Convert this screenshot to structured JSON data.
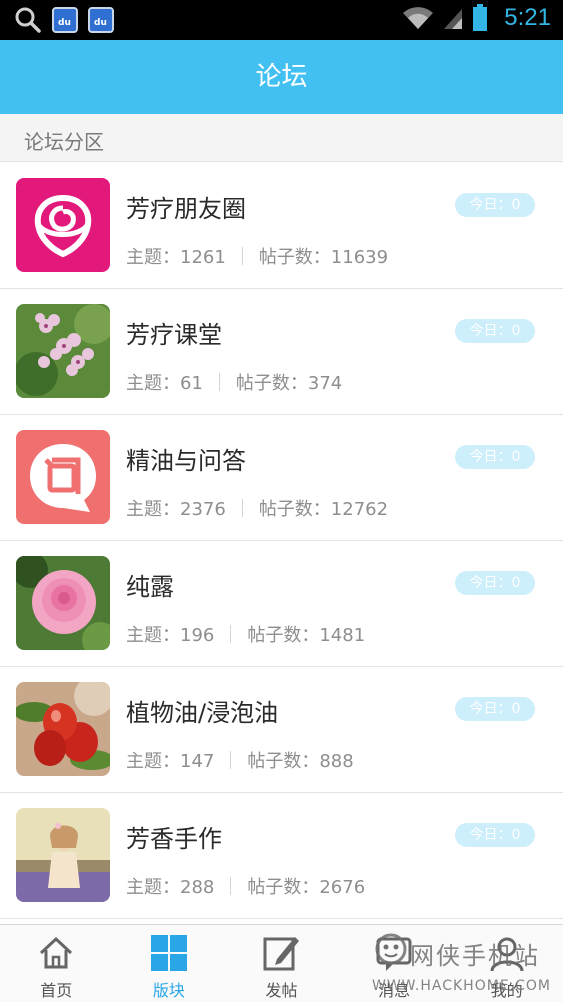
{
  "status_bar": {
    "time": "5:21",
    "icons": [
      "search-icon",
      "baidu-icon",
      "baidu-icon",
      "wifi-icon",
      "signal-icon",
      "battery-icon"
    ],
    "baidu_text": "du"
  },
  "header": {
    "title": "论坛"
  },
  "section": {
    "label": "论坛分区"
  },
  "forums": [
    {
      "name": "芳疗朋友圈",
      "topics": "主题：1261",
      "posts": "帖子数：11639",
      "today": "今日：0",
      "thumb": "rose-logo"
    },
    {
      "name": "芳疗课堂",
      "topics": "主题：61",
      "posts": "帖子数：374",
      "today": "今日：0",
      "thumb": "geranium-photo"
    },
    {
      "name": "精油与问答",
      "topics": "主题：2376",
      "posts": "帖子数：12762",
      "today": "今日：0",
      "thumb": "wen-chat-logo"
    },
    {
      "name": "纯露",
      "topics": "主题：196",
      "posts": "帖子数：1481",
      "today": "今日：0",
      "thumb": "pink-rose-photo"
    },
    {
      "name": "植物油/浸泡油",
      "topics": "主题：147",
      "posts": "帖子数：888",
      "today": "今日：0",
      "thumb": "rosehip-photo"
    },
    {
      "name": "芳香手作",
      "topics": "主题：288",
      "posts": "帖子数：2676",
      "today": "今日：0",
      "thumb": "girl-lavender-photo"
    }
  ],
  "nav": [
    {
      "label": "首页",
      "icon": "home-icon",
      "active": false
    },
    {
      "label": "版块",
      "icon": "grid-icon",
      "active": true
    },
    {
      "label": "发帖",
      "icon": "edit-icon",
      "active": false
    },
    {
      "label": "消息",
      "icon": "message-icon",
      "active": false
    },
    {
      "label": "我的",
      "icon": "profile-icon",
      "active": false
    }
  ],
  "watermark": {
    "line1": "网侠手机站",
    "line2": "WWW.HACKHOME.COM"
  },
  "colors": {
    "header": "#42c0f2",
    "accent": "#2aa6e6",
    "badge": "#cdeefb"
  }
}
